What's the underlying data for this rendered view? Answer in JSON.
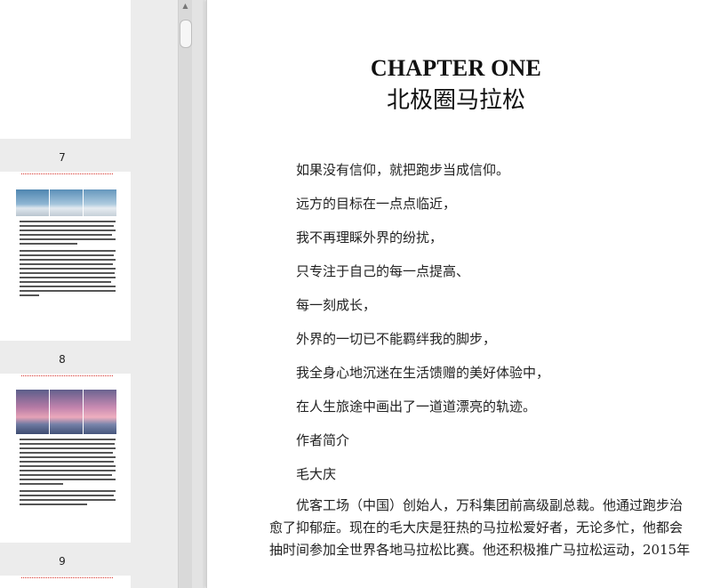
{
  "thumbnails": {
    "pages": [
      {
        "number": "7"
      },
      {
        "number": "8"
      },
      {
        "number": "9"
      }
    ]
  },
  "scrollbar": {
    "up_arrow": "▲"
  },
  "document": {
    "chapter_title": "CHAPTER ONE",
    "chapter_subtitle": "北极圈马拉松",
    "poem_lines": [
      "如果没有信仰，就把跑步当成信仰。",
      "远方的目标在一点点临近，",
      "我不再理睬外界的纷扰，",
      "只专注于自己的每一点提高、",
      "每一刻成长，",
      "外界的一切已不能羁绊我的脚步，",
      "我全身心地沉迷在生活馈赠的美好体验中，",
      "在人生旅途中画出了一道道漂亮的轨迹。",
      "作者简介",
      "毛大庆"
    ],
    "body_lines": [
      "优客工场（中国）创始人，万科集团前高级副总裁。他通过跑步治",
      "愈了抑郁症。现在的毛大庆是狂热的马拉松爱好者，无论多忙，他都会",
      "抽时间参加全世界各地马拉松比赛。他还积极推广马拉松运动，2015年"
    ]
  },
  "colors": {
    "header_rule": "#d8342c",
    "thumb_snow_sky": "#5d8fb3",
    "thumb_sunset": "#d97a9a"
  }
}
